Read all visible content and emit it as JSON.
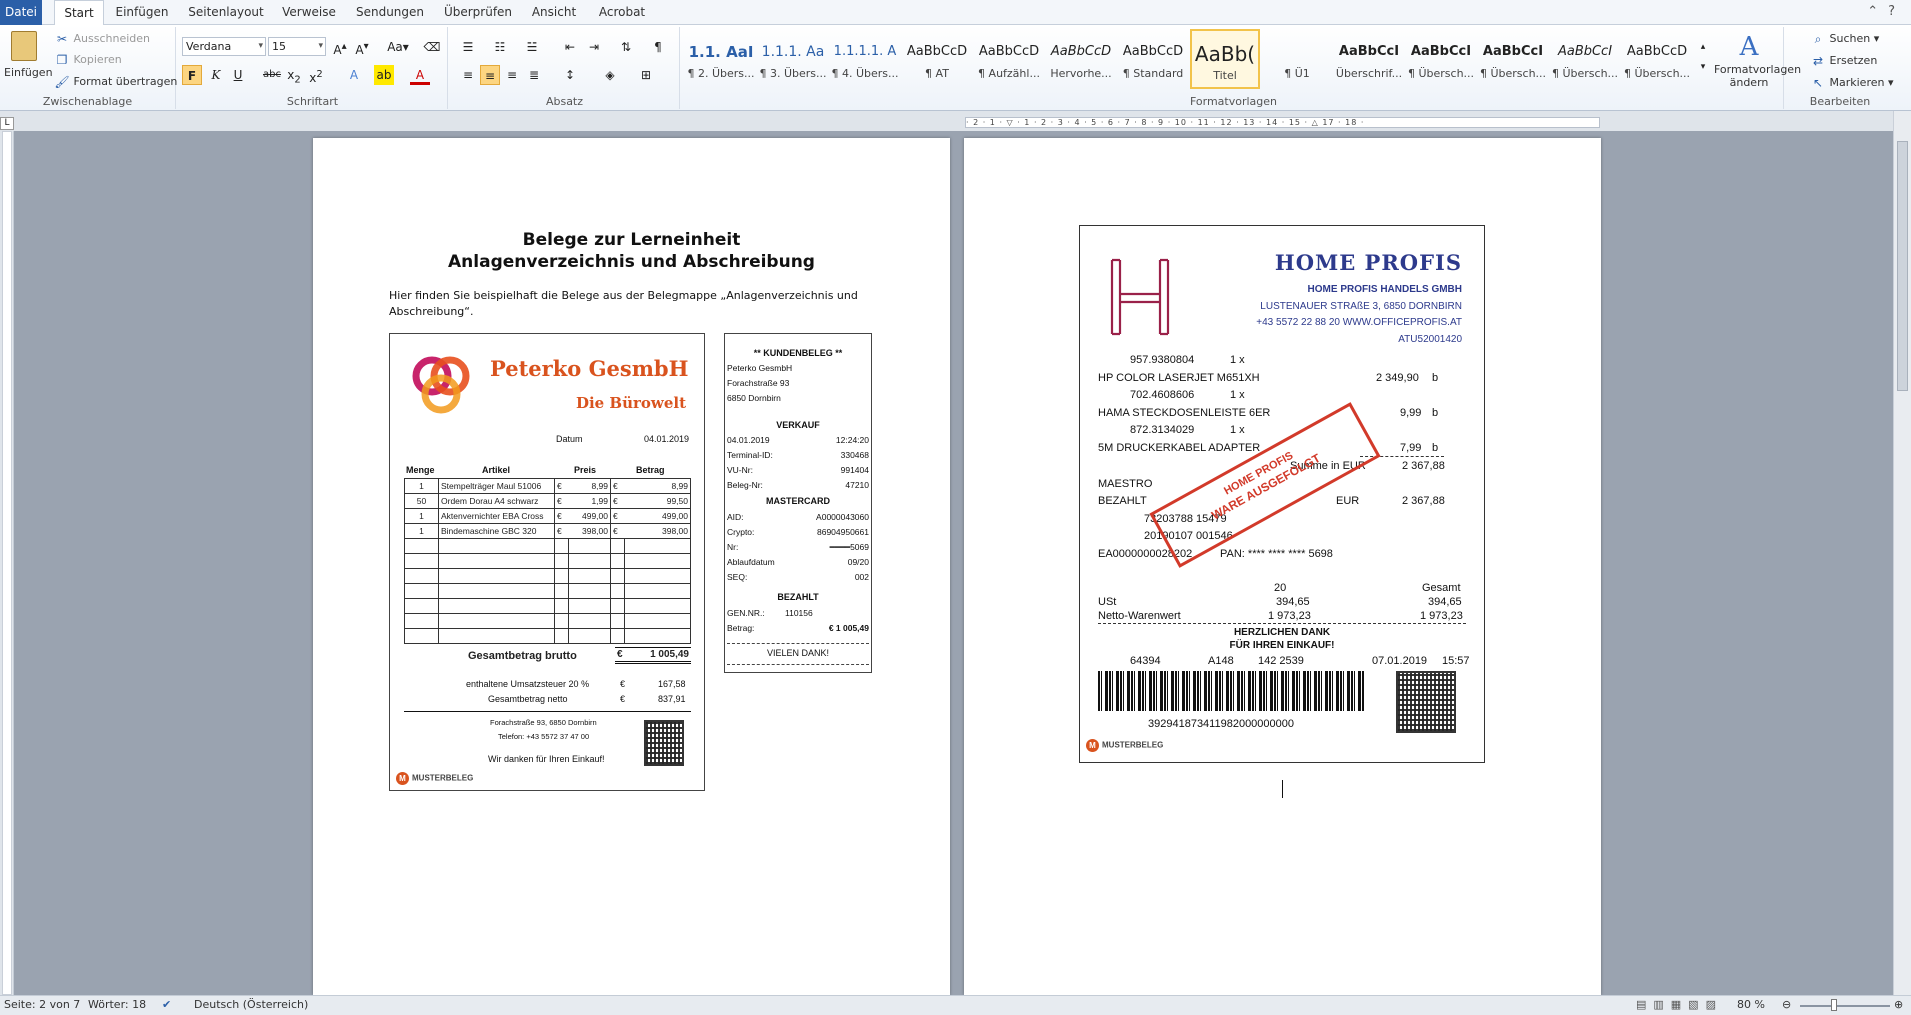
{
  "tabs": [
    "Datei",
    "Start",
    "Einfügen",
    "Seitenlayout",
    "Verweise",
    "Sendungen",
    "Überprüfen",
    "Ansicht",
    "Acrobat"
  ],
  "clipboard": {
    "paste": "Einfügen",
    "cut": "Ausschneiden",
    "copy": "Kopieren",
    "format_painter": "Format übertragen",
    "title": "Zwischenablage"
  },
  "font": {
    "name": "Verdana",
    "size": "15",
    "title": "Schriftart"
  },
  "paragraph": {
    "title": "Absatz"
  },
  "styles": {
    "title": "Formatvorlagen",
    "change": "Formatvorlagen ändern",
    "items": [
      {
        "preview": "1.1.  AaI",
        "name": "¶ 2. Übers..."
      },
      {
        "preview": "1.1.1.  Aa",
        "name": "¶ 3. Übers..."
      },
      {
        "preview": "1.1.1.1.  A",
        "name": "¶ 4. Übers..."
      },
      {
        "preview": "AaBbCcD",
        "name": "¶ AT"
      },
      {
        "preview": "AaBbCcD",
        "name": "¶ Aufzähl..."
      },
      {
        "preview": "AaBbCcD",
        "name": "Hervorhe..."
      },
      {
        "preview": "AaBbCcD",
        "name": "¶ Standard"
      },
      {
        "preview": "AaBb(",
        "name": "Titel"
      },
      {
        "preview": "",
        "name": "¶ Ü1"
      },
      {
        "preview": "AaBbCcI",
        "name": "Überschrif..."
      },
      {
        "preview": "AaBbCcI",
        "name": "¶ Übersch..."
      },
      {
        "preview": "AaBbCcI",
        "name": "¶ Übersch..."
      },
      {
        "preview": "AaBbCcI",
        "name": "¶ Übersch..."
      },
      {
        "preview": "AaBbCcD",
        "name": "¶ Übersch..."
      }
    ]
  },
  "editing": {
    "find": "Suchen",
    "replace": "Ersetzen",
    "select": "Markieren",
    "title": "Bearbeiten"
  },
  "ruler_ticks": "· 2 · 1 · ▽ · 1 · 2 · 3 · 4 · 5 · 6 · 7 · 8 · 9 · 10 · 11 · 12 · 13 · 14 · 15 · △ 17 · 18 ·",
  "page1": {
    "title_line1": "Belege zur Lerneinheit",
    "title_line2": "Anlagenverzeichnis und Abschreibung",
    "intro": "Hier finden Sie beispielhaft die Belege aus der Belegmappe „Anlagenverzeichnis und Abschreibung“.",
    "receipt_a": {
      "company": "Peterko GesmbH",
      "subtitle": "Die Bürowelt",
      "date_label": "Datum",
      "date": "04.01.2019",
      "headers": [
        "Menge",
        "Artikel",
        "Preis",
        "Betrag"
      ],
      "rows": [
        [
          "1",
          "Stempelträger Maul 51006",
          "€",
          "8,99",
          "€",
          "8,99"
        ],
        [
          "50",
          "Ordem Dorau A4 schwarz",
          "€",
          "1,99",
          "€",
          "99,50"
        ],
        [
          "1",
          "Aktenvernichter EBA Cross",
          "€",
          "499,00",
          "€",
          "499,00"
        ],
        [
          "1",
          "Bindemaschine GBC 320",
          "€",
          "398,00",
          "€",
          "398,00"
        ]
      ],
      "total_label": "Gesamtbetrag brutto",
      "total_cur": "€",
      "total": "1 005,49",
      "vat_label": "enthaltene Umsatzsteuer 20 %",
      "vat_cur": "€",
      "vat": "167,58",
      "net_label": "Gesamtbetrag netto",
      "net_cur": "€",
      "net": "837,91",
      "address": "Forachstraße 93, 6850 Dornbirn",
      "phone": "Telefon: +43 5572 37 47 00",
      "thanks": "Wir danken für Ihren Einkauf!",
      "badge": "MUSTERBELEG"
    },
    "receipt_b": {
      "head": "** KUNDENBELEG **",
      "addr1": "Peterko GesmbH",
      "addr2": "Forachstraße 93",
      "addr3": "6850 Dornbirn",
      "sale": "VERKAUF",
      "date": "04.01.2019",
      "time": "12:24:20",
      "rows": [
        [
          "Terminal-ID:",
          "330468"
        ],
        [
          "VU-Nr:",
          "991404"
        ],
        [
          "Beleg-Nr:",
          "47210"
        ]
      ],
      "card": "MASTERCARD",
      "card_rows": [
        [
          "AID:",
          "A0000043060"
        ],
        [
          "Crypto:",
          "86904950661"
        ],
        [
          "Nr:",
          "━━━━5069"
        ],
        [
          "Ablaufdatum",
          "09/20"
        ],
        [
          "SEQ:",
          "002"
        ]
      ],
      "paid": "BEZAHLT",
      "gen_label": "GEN.NR.:",
      "gen": "110156",
      "amount_label": "Betrag:",
      "amount": "€ 1 005,49",
      "thanks": "VIELEN DANK!"
    }
  },
  "page2": {
    "receipt_c": {
      "brand": "HOME PROFIS",
      "company": "HOME PROFIS HANDELS GMBH",
      "street": "LUSTENAUER STRAßE 3,  6850 DORNBIRN",
      "contact": "+43 5572 22 88 20  WWW.OFFICEPROFIS.AT",
      "uid": "ATU52001420",
      "items": [
        {
          "code": "957.9380804",
          "qty": "1 x",
          "name": "HP COLOR LASERJET M651XH",
          "price": "2 349,90",
          "flag": "b"
        },
        {
          "code": "702.4608606",
          "qty": "1 x",
          "name": "HAMA STECKDOSENLEISTE 6ER",
          "price": "9,99",
          "flag": "b"
        },
        {
          "code": "872.3134029",
          "qty": "1 x",
          "name": "5M DRUCKERKABEL ADAPTER",
          "price": "7,99",
          "flag": "b"
        }
      ],
      "sum_label": "Summe in EUR",
      "sum": "2 367,88",
      "pay1": "MAESTRO",
      "pay2": "BEZAHLT",
      "pay_cur": "EUR",
      "pay_amount": "2 367,88",
      "ref1": "73203788  15479",
      "ref2": "20190107 001546",
      "ref3": "EA0000000028202",
      "pan": "PAN:  **** **** ****  5698",
      "vat_col": "20",
      "total_col": "Gesamt",
      "vat_label": "USt",
      "vat": "394,65",
      "vat_total": "394,65",
      "net_label": "Netto-Warenwert",
      "net": "1 973,23",
      "net_total": "1 973,23",
      "thanks1": "HERZLICHEN DANK",
      "thanks2": "FÜR IHREN EINKAUF!",
      "footer_a": "64394",
      "footer_b": "A148",
      "footer_c": "142  2539",
      "footer_date": "07.01.2019",
      "footer_time": "15:57",
      "barcode_num": "392941873411982000000000",
      "stamp1": "HOME PROFIS",
      "stamp2": "WARE AUSGEFOLGT",
      "badge": "MUSTERBELEG"
    }
  },
  "status": {
    "page": "Seite: 2 von 7",
    "words": "Wörter: 18",
    "lang": "Deutsch (Österreich)",
    "zoom": "80 %"
  },
  "colors": {
    "accent": "#2b5fa8",
    "brand_orange": "#d9531e",
    "brand_blue": "#2d3a8c",
    "stamp_red": "#d23a2a"
  }
}
